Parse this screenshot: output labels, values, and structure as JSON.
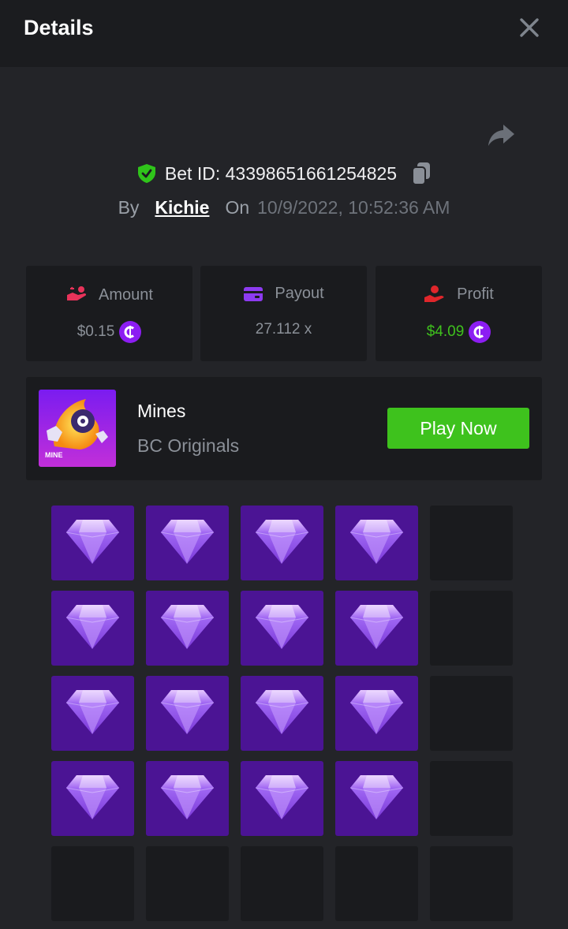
{
  "header": {
    "title": "Details"
  },
  "bet": {
    "id_label": "Bet ID: 4339865166125482­5",
    "by_label": "By",
    "user": "Kichie",
    "on_label": "On",
    "datetime": "10/9/2022, 10:52:36 AM"
  },
  "stats": {
    "amount": {
      "label": "Amount",
      "value": "$0.15"
    },
    "payout": {
      "label": "Payout",
      "value": "27.112 x"
    },
    "profit": {
      "label": "Profit",
      "value": "$4.09"
    }
  },
  "game": {
    "name": "Mines",
    "provider": "BC Originals",
    "thumb_label": "MINE",
    "play_label": "Play Now"
  },
  "board": {
    "columns": 5,
    "rows": 5,
    "cells": [
      "gem",
      "gem",
      "gem",
      "gem",
      "empty",
      "gem",
      "gem",
      "gem",
      "gem",
      "empty",
      "gem",
      "gem",
      "gem",
      "gem",
      "empty",
      "gem",
      "gem",
      "gem",
      "gem",
      "empty",
      "empty",
      "empty",
      "empty",
      "empty",
      "empty"
    ]
  },
  "colors": {
    "accent_green": "#3ec21d",
    "coin_purple": "#8c1df2",
    "gem_tile": "#4b1494",
    "shield_green": "#2fc41a"
  },
  "icons": {
    "close": "close-icon",
    "share": "share-icon",
    "verified": "shield-check-icon",
    "copy": "copy-icon",
    "amount": "hand-coins-icon",
    "payout": "wallet-icon",
    "profit": "profit-hand-icon",
    "currency": "coin-icon",
    "gem": "diamond-icon"
  }
}
